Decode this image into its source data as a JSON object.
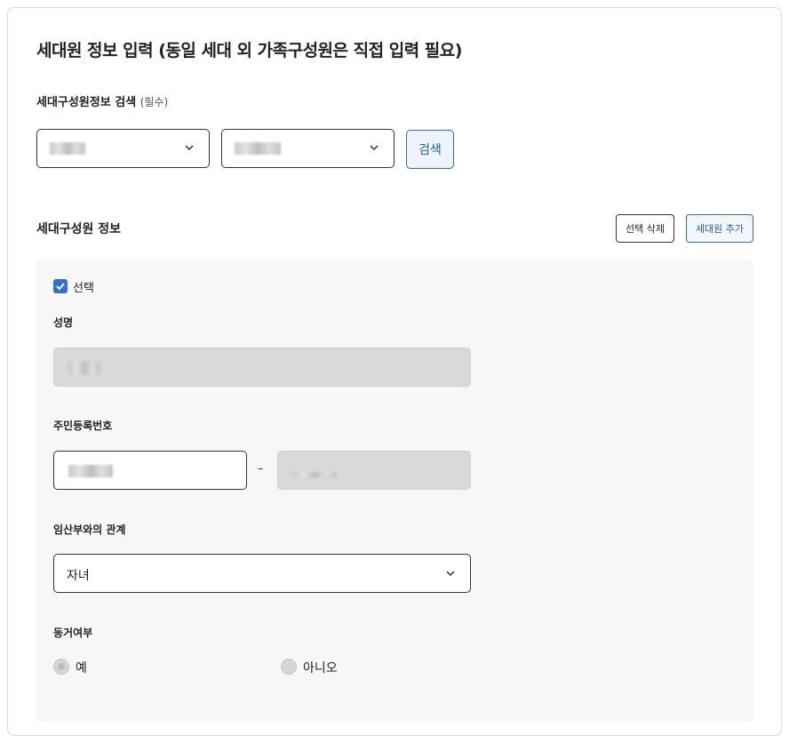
{
  "title": "세대원 정보 입력 (동일 세대 외 가족구성원은 직접 입력 필요)",
  "search": {
    "label": "세대구성원정보 검색",
    "required": "(필수)",
    "button_label": "검색"
  },
  "members": {
    "section_title": "세대구성원 정보",
    "delete_label": "선택 삭제",
    "add_label": "세대원 추가",
    "select_label": "선택",
    "name_label": "성명",
    "rrn_label": "주민등록번호",
    "rrn_separator": "–",
    "relation_label": "임산부와의 관계",
    "relation_value": "자녀",
    "cohabit_label": "동거여부",
    "cohabit_yes": "예",
    "cohabit_no": "아니오"
  },
  "colors": {
    "accent": "#2f6fd6",
    "button_blue": "#1f5ea8"
  }
}
